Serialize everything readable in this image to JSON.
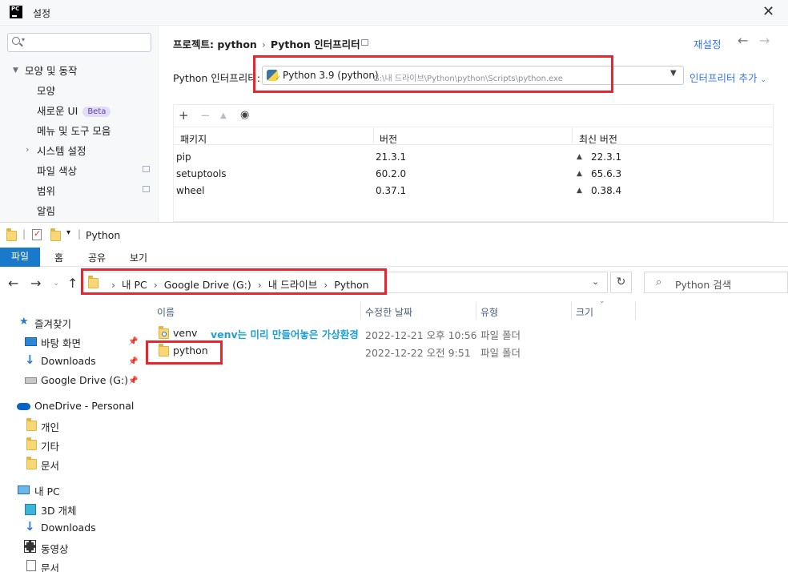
{
  "pycharm": {
    "window_title": "설정",
    "logo_text": "PC",
    "close_glyph": "✕",
    "sidebar": {
      "tree": [
        {
          "label": "모양 및 동작",
          "level": 0,
          "expanded": true
        },
        {
          "label": "모양",
          "level": 1
        },
        {
          "label": "새로운 UI",
          "level": 1,
          "badge": "Beta"
        },
        {
          "label": "메뉴 및 도구 모음",
          "level": 1
        },
        {
          "label": "시스템 설정",
          "level": 1,
          "expandable": true
        },
        {
          "label": "파일 색상",
          "level": 1,
          "scope_icon": true
        },
        {
          "label": "범위",
          "level": 1,
          "scope_icon": true
        },
        {
          "label": "알림",
          "level": 1
        }
      ]
    },
    "breadcrumb": {
      "project": "프로젝트: python",
      "separator": "›",
      "page": "Python 인터프리터"
    },
    "reset_label": "재설정",
    "interpreter": {
      "label": "Python 인터프리터:",
      "name": "Python 3.9 (python)",
      "path": "G:\\내 드라이브\\Python\\python\\Scripts\\python.exe",
      "add_label": "인터프리터 추가"
    },
    "packages": {
      "columns": [
        "패키지",
        "버전",
        "최신 버전"
      ],
      "rows": [
        {
          "package": "pip",
          "version": "21.3.1",
          "latest": "22.3.1"
        },
        {
          "package": "setuptools",
          "version": "60.2.0",
          "latest": "65.6.3"
        },
        {
          "package": "wheel",
          "version": "0.37.1",
          "latest": "0.38.4"
        }
      ]
    }
  },
  "explorer": {
    "title": "Python",
    "ribbon_tabs": [
      "파일",
      "홈",
      "공유",
      "보기"
    ],
    "address": [
      "내 PC",
      "Google Drive (G:)",
      "내 드라이브",
      "Python"
    ],
    "search_placeholder": "Python 검색",
    "nav": {
      "quick_access": "즐겨찾기",
      "quick_items": [
        "바탕 화면",
        "Downloads",
        "Google Drive (G:)"
      ],
      "onedrive": "OneDrive - Personal",
      "onedrive_items": [
        "개인",
        "기타",
        "문서"
      ],
      "this_pc": "내 PC",
      "pc_items": [
        "3D 개체",
        "Downloads",
        "동영상",
        "문서"
      ]
    },
    "columns": [
      "이름",
      "수정한 날짜",
      "유형",
      "크기"
    ],
    "files": [
      {
        "name": "venv",
        "modified": "2022-12-21 오후 10:56",
        "type": "파일 폴더"
      },
      {
        "name": "python",
        "modified": "2022-12-22 오전 9:51",
        "type": "파일 폴더"
      }
    ],
    "annotation": "venv는 미리 만들어놓은 가상환경"
  },
  "colors": {
    "accent_blue": "#3574f0",
    "annotation_red": "#e8262f",
    "explorer_file_tab": "#1979ca",
    "annotation_text": "#1ea0d6"
  }
}
